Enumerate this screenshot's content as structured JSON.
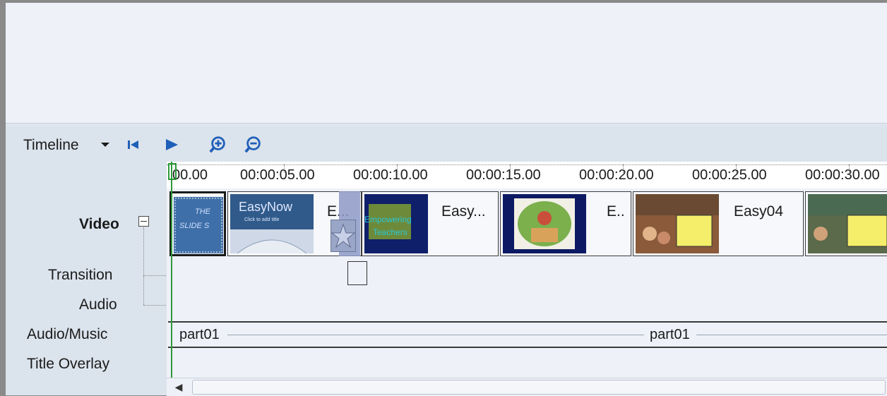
{
  "toolbar": {
    "view_label": "Timeline",
    "icons": [
      "dropdown-arrow-icon",
      "rewind-icon",
      "play-icon",
      "zoom-in-icon",
      "zoom-out-icon"
    ]
  },
  "tracks": {
    "video": "Video",
    "transition": "Transition",
    "audio": "Audio",
    "audio_music": "Audio/Music",
    "title_overlay": "Title Overlay"
  },
  "ruler": {
    "ticks": [
      "00.00",
      "00:00:05.00",
      "00:00:10.00",
      "00:00:15.00",
      "00:00:20.00",
      "00:00:25.00",
      "00:00:30.00"
    ]
  },
  "clips": [
    {
      "name": "",
      "thumb_text": "THE SLIDE S"
    },
    {
      "name": "E...",
      "thumb_text": "EasyNow"
    },
    {
      "name": "Easy...",
      "thumb_text": "Empowering Teachers"
    },
    {
      "name": "E..",
      "thumb_text": ""
    },
    {
      "name": "Easy04",
      "thumb_text": ""
    },
    {
      "name": "",
      "thumb_text": ""
    }
  ],
  "music": [
    {
      "name": "part01"
    },
    {
      "name": "part01"
    }
  ],
  "colors": {
    "playhead": "#2e9a3a",
    "accent_icon": "#1f5fb8",
    "panel": "#dbe3ec"
  }
}
